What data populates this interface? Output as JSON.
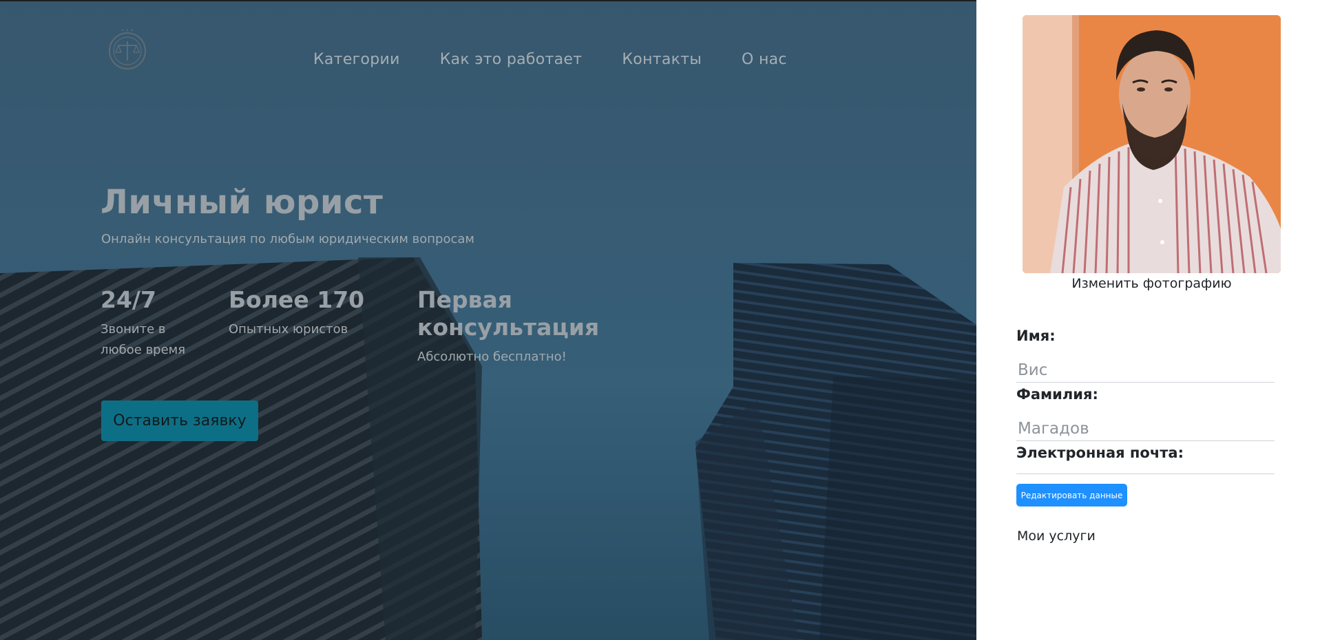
{
  "nav": {
    "items": [
      "Категории",
      "Как это работает",
      "Контакты",
      "О нас"
    ]
  },
  "hero": {
    "title": "Личный юрист",
    "subtitle": "Онлайн консультация по любым юридическим вопросам",
    "stats": [
      {
        "value": "24/7",
        "label_line1": "Звоните в",
        "label_line2": "любое время"
      },
      {
        "value": "Более 170",
        "label_line1": "Опытных юристов",
        "label_line2": ""
      },
      {
        "value": "Первая консультация",
        "label_line1": "Абсолютно бесплатно!",
        "label_line2": ""
      }
    ],
    "cta_label": "Оставить заявку"
  },
  "profile": {
    "change_photo_label": "Изменить фотографию",
    "first_name_label": "Имя:",
    "first_name_value": "Вис",
    "last_name_label": "Фамилия:",
    "last_name_value": "Магадов",
    "email_label": "Электронная почта:",
    "email_value": "",
    "edit_button_label": "Редактировать данные",
    "services_label": "Мои услуги"
  },
  "colors": {
    "cta_bg": "#0d6f85",
    "edit_button_bg": "#1e90ff",
    "photo_bg": "#e9874a"
  },
  "icons": {
    "logo": "scales-of-justice-emblem"
  }
}
